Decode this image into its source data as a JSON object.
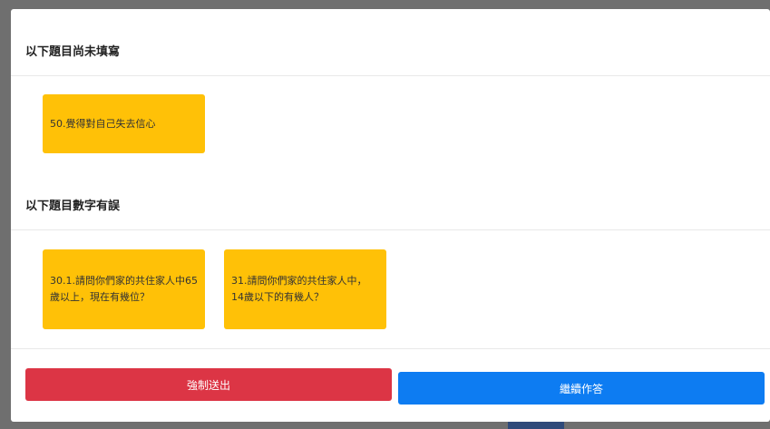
{
  "modal": {
    "sections": [
      {
        "title": "以下題目尚未填寫",
        "items": [
          "50.覺得對自己失去信心"
        ]
      },
      {
        "title": "以下題目數字有誤",
        "items": [
          "30.1.請問你們家的共住家人中65歲以上，現在有幾位？",
          "31.請問你們家的共住家人中，14歲以下的有幾人？"
        ]
      }
    ],
    "buttons": {
      "force_submit": "強制送出",
      "continue": "繼續作答"
    }
  },
  "colors": {
    "card": "#ffc107",
    "danger": "#dc3545",
    "primary": "#0d7cf2"
  }
}
